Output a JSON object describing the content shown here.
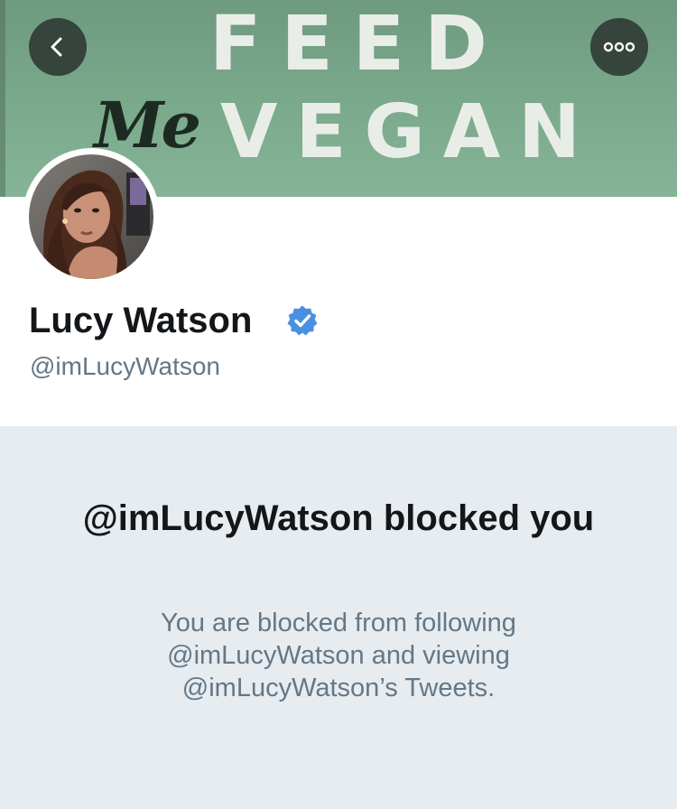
{
  "banner": {
    "line1": "FEED",
    "line2_script": "Me",
    "line2": "VEGAN"
  },
  "nav": {
    "back_icon": "chevron-left-icon",
    "more_icon": "more-options-icon"
  },
  "profile": {
    "display_name": "Lucy Watson",
    "verified_icon": "verified-badge-icon",
    "handle": "@imLucyWatson",
    "accent_color": "#4a90e2"
  },
  "blocked_notice": {
    "title": "@imLucyWatson blocked you",
    "body": "You are blocked from following @imLucyWatson and viewing @imLucyWatson’s Tweets."
  }
}
